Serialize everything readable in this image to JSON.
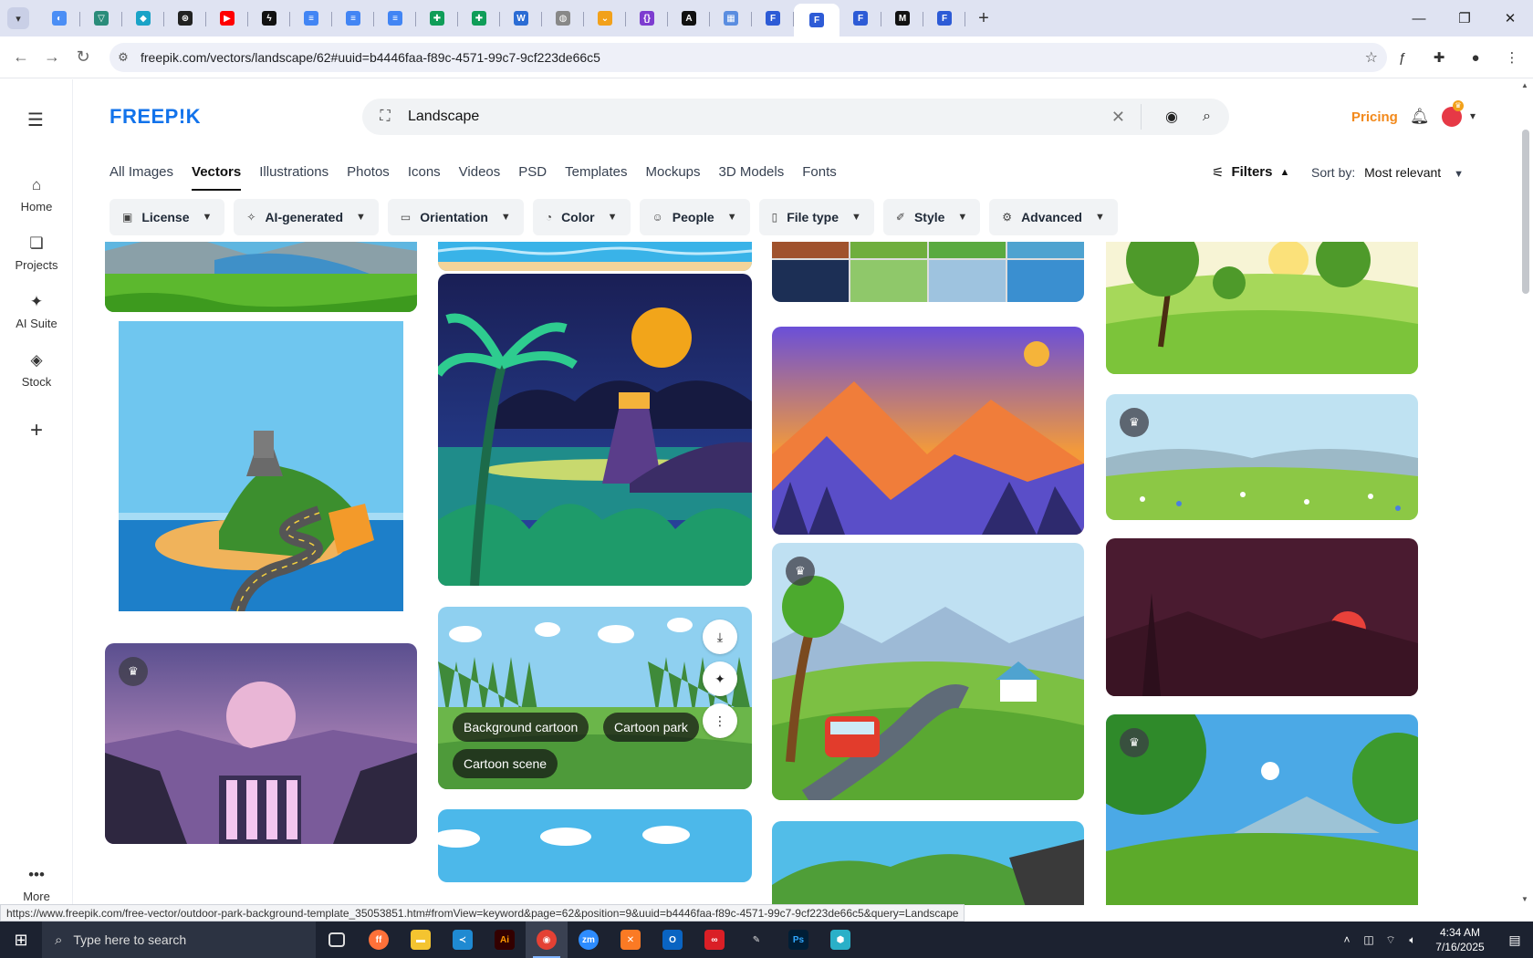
{
  "browser": {
    "tabs": [
      {
        "icon": "google-drive-icon",
        "color": "#4b8ef5"
      },
      {
        "icon": "vpn-icon",
        "color": "#2a8c7a"
      },
      {
        "icon": "codepen-icon",
        "color": "#1aa3c7"
      },
      {
        "icon": "openai-icon",
        "color": "#222222"
      },
      {
        "icon": "youtube-icon",
        "color": "#ff0000"
      },
      {
        "icon": "bolt-icon",
        "color": "#111111"
      },
      {
        "icon": "google-docs-icon",
        "color": "#4285f4"
      },
      {
        "icon": "google-docs-icon",
        "color": "#4285f4"
      },
      {
        "icon": "google-docs-icon",
        "color": "#4285f4"
      },
      {
        "icon": "google-sheets-icon",
        "color": "#0f9d58"
      },
      {
        "icon": "google-sheets-icon",
        "color": "#0f9d58"
      },
      {
        "icon": "word-icon",
        "color": "#2b6cd4"
      },
      {
        "icon": "globe-icon",
        "color": "#888888"
      },
      {
        "icon": "bookmark-icon",
        "color": "#f2a11b"
      },
      {
        "icon": "braces-icon",
        "color": "#7d3cd0"
      },
      {
        "icon": "ai-app-icon",
        "color": "#111111"
      },
      {
        "icon": "grid-app-icon",
        "color": "#5a8de0"
      },
      {
        "icon": "freepik-tab-icon",
        "color": "#2d5bd6"
      },
      {
        "icon": "freepik-tab-icon",
        "color": "#2d5bd6",
        "active": true
      },
      {
        "icon": "freepik-tab-icon",
        "color": "#2d5bd6"
      },
      {
        "icon": "medium-icon",
        "color": "#111111"
      },
      {
        "icon": "freepik-tab-icon",
        "color": "#2d5bd6"
      }
    ],
    "url": "freepik.com/vectors/landscape/62#uuid=b4446faa-f89c-4571-99c7-9cf223de66c5",
    "status_url": "https://www.freepik.com/free-vector/outdoor-park-background-template_35053851.htm#fromView=keyword&page=62&position=9&uuid=b4446faa-f89c-4571-99c7-9cf223de66c5&query=Landscape"
  },
  "rail": {
    "items": [
      {
        "label": "Home",
        "icon": "home-icon"
      },
      {
        "label": "Projects",
        "icon": "projects-icon"
      },
      {
        "label": "AI Suite",
        "icon": "sparkles-icon"
      },
      {
        "label": "Stock",
        "icon": "stock-icon"
      }
    ],
    "more_label": "More"
  },
  "header": {
    "logo": "FREEP!K",
    "search_value": "Landscape",
    "pricing": "Pricing",
    "accent": "#f2891b",
    "brand": "#1273eb"
  },
  "categories": [
    "All Images",
    "Vectors",
    "Illustrations",
    "Photos",
    "Icons",
    "Videos",
    "PSD",
    "Templates",
    "Mockups",
    "3D Models",
    "Fonts"
  ],
  "active_category": "Vectors",
  "filters_label": "Filters",
  "sort": {
    "label": "Sort by:",
    "value": "Most relevant"
  },
  "chips": [
    {
      "label": "License",
      "icon": "license-icon"
    },
    {
      "label": "AI-generated",
      "icon": "ai-icon"
    },
    {
      "label": "Orientation",
      "icon": "orientation-icon"
    },
    {
      "label": "Color",
      "icon": "palette-icon"
    },
    {
      "label": "People",
      "icon": "people-icon"
    },
    {
      "label": "File type",
      "icon": "file-icon"
    },
    {
      "label": "Style",
      "icon": "brush-icon"
    },
    {
      "label": "Advanced",
      "icon": "settings-icon"
    }
  ],
  "hover_card": {
    "tags": [
      "Background cartoon",
      "Cartoon park",
      "Cartoon scene"
    ]
  },
  "taskbar": {
    "search_placeholder": "Type here to search",
    "time": "4:34 AM",
    "date": "7/16/2025"
  }
}
